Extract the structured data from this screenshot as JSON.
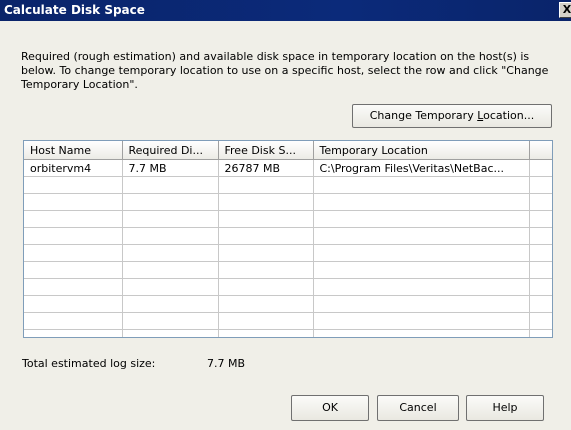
{
  "dialog": {
    "title": "Calculate Disk Space",
    "close_glyph": "X",
    "description": "Required (rough estimation) and available disk space in temporary location on the host(s) is below. To change temporary location to use on a specific host, select the row and click \"Change Temporary Location\".",
    "change_location_button": {
      "pre": "Change Temporary ",
      "accel": "L",
      "post": "ocation..."
    }
  },
  "table": {
    "columns": [
      "Host Name",
      "Required Di...",
      "Free Disk S...",
      "Temporary Location",
      ""
    ],
    "rows": [
      [
        "orbitervm4",
        "7.7 MB",
        "26787 MB",
        "C:\\Program Files\\Veritas\\NetBac...",
        ""
      ]
    ]
  },
  "log": {
    "label": "Total estimated log size:",
    "value": "7.7 MB"
  },
  "buttons": {
    "ok": "OK",
    "cancel": "Cancel",
    "help": "Help"
  }
}
